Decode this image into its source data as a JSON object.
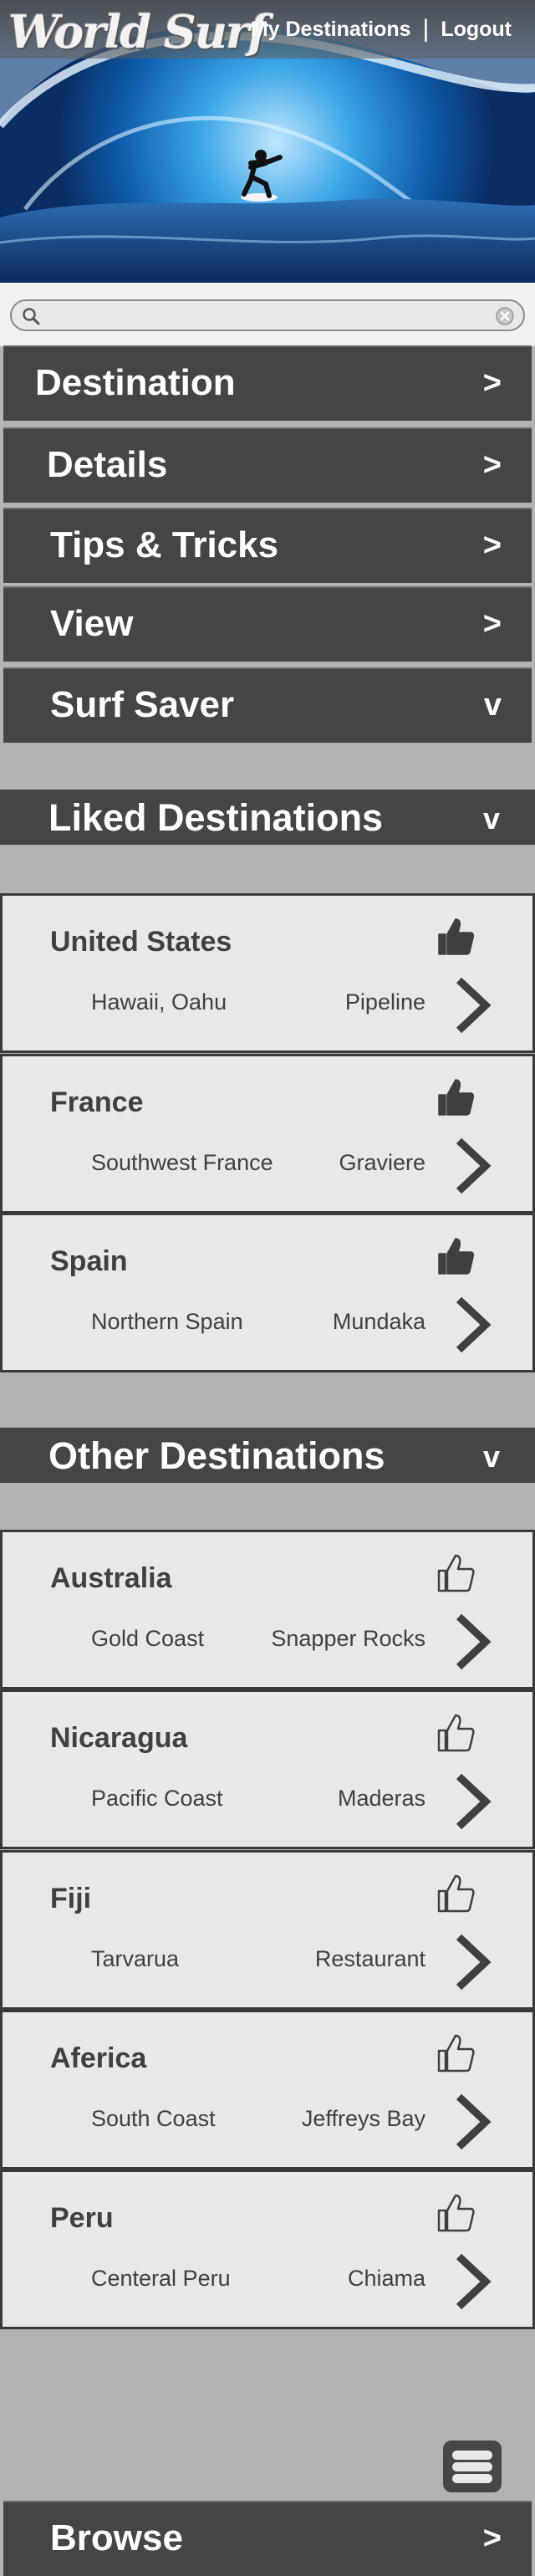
{
  "header": {
    "logo_text": "World Surf",
    "nav": {
      "my_destinations": "My Destinations",
      "separator": "|",
      "logout": "Logout"
    }
  },
  "search": {
    "placeholder": "",
    "value": ""
  },
  "menu": [
    {
      "label": "Destination",
      "chevron": ">"
    },
    {
      "label": "Details",
      "chevron": ">"
    },
    {
      "label": "Tips & Tricks",
      "chevron": ">"
    },
    {
      "label": "View",
      "chevron": ">"
    },
    {
      "label": "Surf Saver",
      "chevron": "v"
    }
  ],
  "liked": {
    "title": "Liked Destinations",
    "chevron": "v",
    "items": [
      {
        "country": "United States",
        "region": "Hawaii, Oahu",
        "spot": "Pipeline",
        "liked": true
      },
      {
        "country": "France",
        "region": "Southwest France",
        "spot": "Graviere",
        "liked": true
      },
      {
        "country": "Spain",
        "region": "Northern Spain",
        "spot": "Mundaka",
        "liked": true
      }
    ]
  },
  "other": {
    "title": "Other Destinations",
    "chevron": "v",
    "items": [
      {
        "country": "Australia",
        "region": "Gold Coast",
        "spot": "Snapper Rocks",
        "liked": false
      },
      {
        "country": "Nicaragua",
        "region": "Pacific Coast",
        "spot": "Maderas",
        "liked": false
      },
      {
        "country": "Fiji",
        "region": "Tarvarua",
        "spot": "Restaurant",
        "liked": false
      },
      {
        "country": "Aferica",
        "region": "South Coast",
        "spot": "Jeffreys Bay",
        "liked": false
      },
      {
        "country": "Peru",
        "region": "Centeral Peru",
        "spot": "Chiama",
        "liked": false
      }
    ]
  },
  "footer": {
    "browse_label": "Browse",
    "browse_chevron": ">"
  },
  "colors": {
    "bar": "#444547",
    "card": "#e7e8ea",
    "background": "#b3b3b3",
    "text": "#404040"
  },
  "icons": [
    "search-icon",
    "clear-icon",
    "thumbs-up-filled-icon",
    "thumbs-up-outline-icon",
    "chevron-right-icon",
    "hamburger-menu-icon"
  ]
}
